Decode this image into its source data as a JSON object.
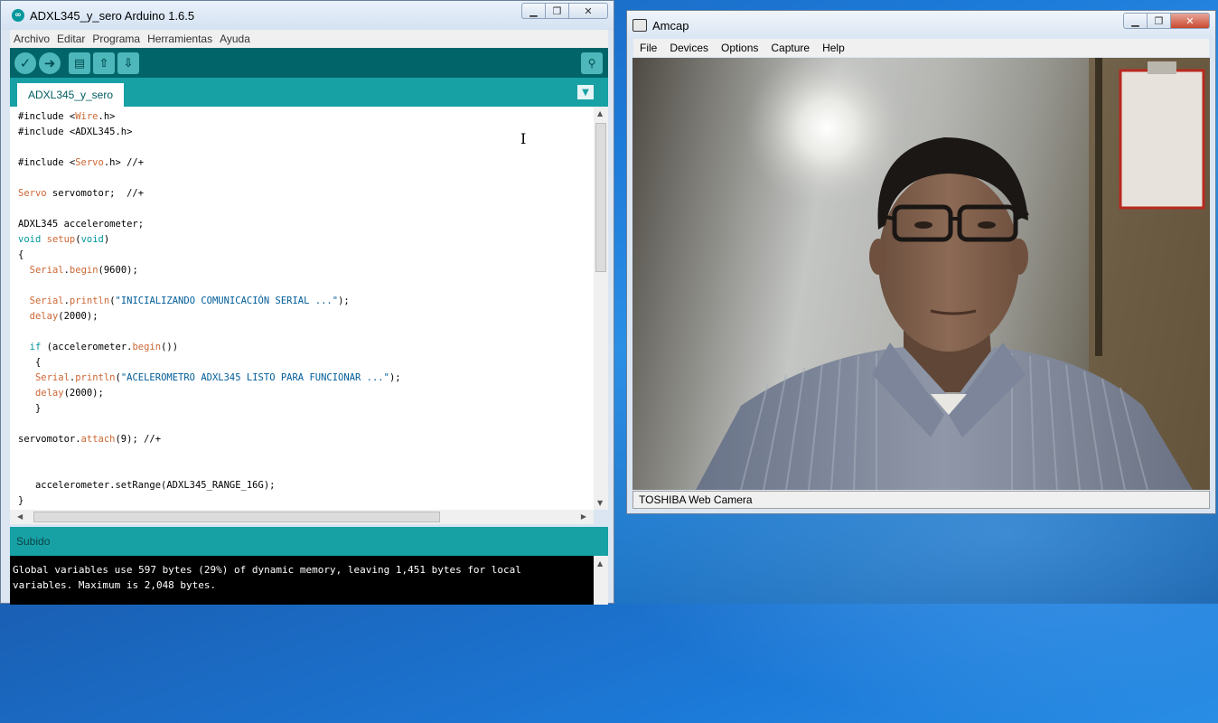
{
  "arduino": {
    "title": "ADXL345_y_sero Arduino 1.6.5",
    "menu": [
      "Archivo",
      "Editar",
      "Programa",
      "Herramientas",
      "Ayuda"
    ],
    "tab_name": "ADXL345_y_sero",
    "code": [
      [
        [
          "#include <",
          ""
        ],
        [
          "Wire",
          "kw"
        ],
        [
          ".h>",
          ""
        ]
      ],
      [
        [
          "#include <ADXL345.h>",
          ""
        ]
      ],
      [],
      [
        [
          "#include <",
          ""
        ],
        [
          "Servo",
          "kw"
        ],
        [
          ".h> //+",
          ""
        ]
      ],
      [],
      [
        [
          "Servo",
          "kw"
        ],
        [
          " servomotor;  //+",
          ""
        ]
      ],
      [],
      [
        [
          "ADXL345 accelerometer;",
          ""
        ]
      ],
      [
        [
          "void",
          "ty"
        ],
        [
          " ",
          ""
        ],
        [
          "setup",
          "kw"
        ],
        [
          "(",
          ""
        ],
        [
          "void",
          "ty"
        ],
        [
          ")",
          ""
        ]
      ],
      [
        [
          "{",
          ""
        ]
      ],
      [
        [
          "  ",
          ""
        ],
        [
          "Serial",
          "kw"
        ],
        [
          ".",
          ""
        ],
        [
          "begin",
          "kw"
        ],
        [
          "(9600);",
          ""
        ]
      ],
      [],
      [
        [
          "  ",
          ""
        ],
        [
          "Serial",
          "kw"
        ],
        [
          ".",
          ""
        ],
        [
          "println",
          "kw"
        ],
        [
          "(",
          ""
        ],
        [
          "\"INICIALIZANDO COMUNICACIÓN SERIAL ...\"",
          "st"
        ],
        [
          ");",
          ""
        ]
      ],
      [
        [
          "  ",
          ""
        ],
        [
          "delay",
          "kw"
        ],
        [
          "(2000);",
          ""
        ]
      ],
      [],
      [
        [
          "  ",
          ""
        ],
        [
          "if",
          "ty"
        ],
        [
          " (accelerometer.",
          ""
        ],
        [
          "begin",
          "kw"
        ],
        [
          "())",
          ""
        ]
      ],
      [
        [
          "   {",
          ""
        ]
      ],
      [
        [
          "   ",
          ""
        ],
        [
          "Serial",
          "kw"
        ],
        [
          ".",
          ""
        ],
        [
          "println",
          "kw"
        ],
        [
          "(",
          ""
        ],
        [
          "\"ACELEROMETRO ADXL345 LISTO PARA FUNCIONAR ...\"",
          "st"
        ],
        [
          ");",
          ""
        ]
      ],
      [
        [
          "   ",
          ""
        ],
        [
          "delay",
          "kw"
        ],
        [
          "(2000);",
          ""
        ]
      ],
      [
        [
          "   }",
          ""
        ]
      ],
      [],
      [
        [
          "servomotor.",
          ""
        ],
        [
          "attach",
          "kw"
        ],
        [
          "(9); //+",
          ""
        ]
      ],
      [],
      [],
      [
        [
          "   accelerometer.setRange(ADXL345_RANGE_16G);",
          ""
        ]
      ],
      [
        [
          "}",
          ""
        ]
      ]
    ],
    "status": "Subido",
    "console": [
      "Global variables use 597 bytes (29%) of dynamic memory, leaving 1,451 bytes for local",
      "variables. Maximum is 2,048 bytes."
    ]
  },
  "amcap": {
    "title": "Amcap",
    "menu": [
      "File",
      "Devices",
      "Options",
      "Capture",
      "Help"
    ],
    "status": "TOSHIBA Web Camera"
  }
}
